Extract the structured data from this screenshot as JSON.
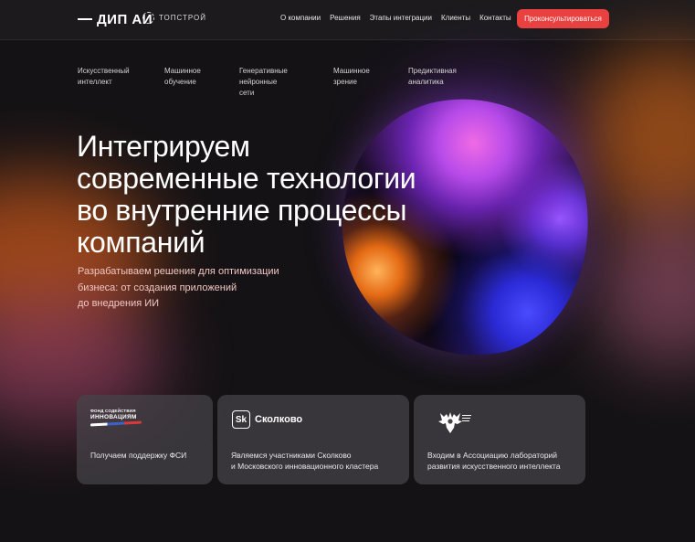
{
  "header": {
    "logo": "ДИП АИ",
    "partner": "ТОПСТРОЙ",
    "nav": [
      "О компании",
      "Решения",
      "Этапы интеграции",
      "Клиенты",
      "Контакты"
    ],
    "cta": "Проконсультироваться"
  },
  "categories": [
    "Искусственный\nинтеллект",
    "Машинное\nобучение",
    "Генеративные\nнейронные сети",
    "Машинное\nзрение",
    "Предиктивная\nаналитика"
  ],
  "hero": {
    "title": "Интегрируем\nсовременные технологии\nво внутренние процессы\nкомпаний",
    "subtitle": "Разрабатываем решения для оптимизации\nбизнеса: от создания приложений\nдо внедрения ИИ"
  },
  "cards": [
    {
      "logo_line1": "ФОНД СОДЕЙСТВИЯ",
      "logo_line2": "ИННОВАЦИЯМ",
      "text": "Получаем поддержку ФСИ"
    },
    {
      "logo_box": "Sk",
      "logo_word": "Сколково",
      "text": "Являемся участниками Сколково\nи Московского инновационного кластера"
    },
    {
      "logo_icon": "eagle-emblem-icon",
      "text": "Входим в Ассоциацию лабораторий\nразвития искусственного интеллекта"
    }
  ],
  "colors": {
    "accent": "#e94040",
    "background": "#141215"
  }
}
